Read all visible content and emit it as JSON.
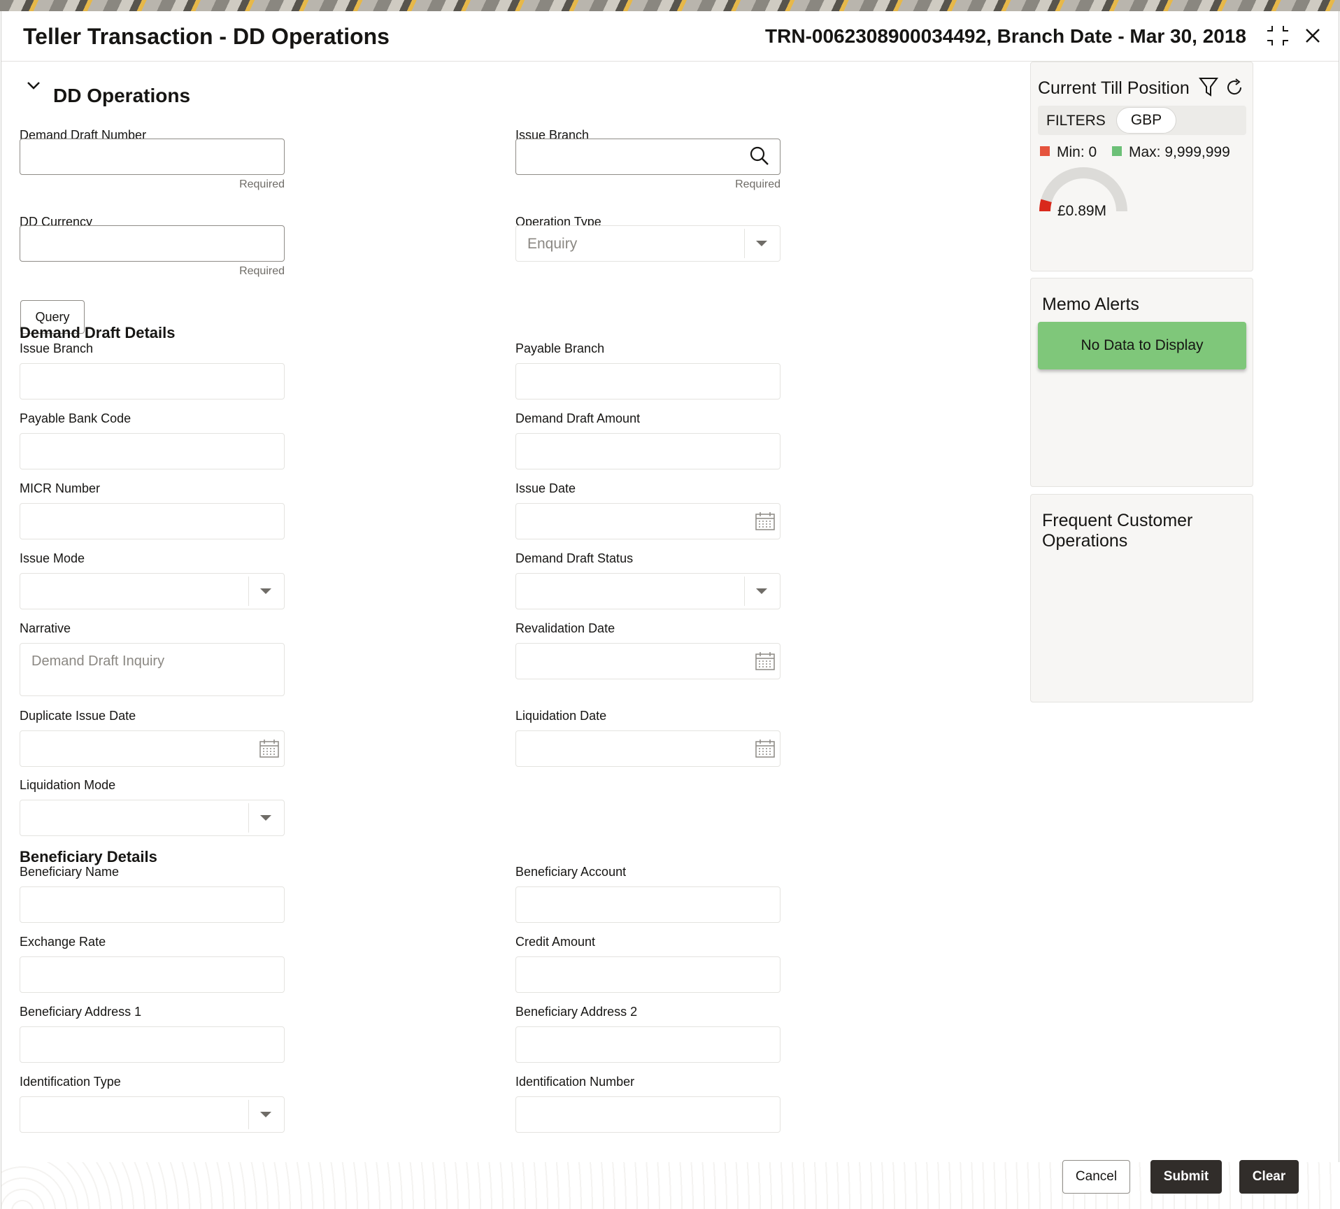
{
  "header": {
    "title": "Teller Transaction - DD Operations",
    "reference": "TRN-0062308900034492, Branch Date - Mar 30, 2018"
  },
  "section": {
    "title": "DD Operations"
  },
  "query_form": {
    "dd_number_label": "Demand Draft Number",
    "issue_branch_label": "Issue Branch",
    "dd_currency_label": "DD Currency",
    "operation_type_label": "Operation Type",
    "operation_type_value": "Enquiry",
    "required_text": "Required",
    "query_button": "Query"
  },
  "dd_details": {
    "heading": "Demand Draft Details",
    "issue_branch_label": "Issue Branch",
    "payable_branch_label": "Payable Branch",
    "payable_bank_code_label": "Payable Bank Code",
    "dd_amount_label": "Demand Draft Amount",
    "micr_label": "MICR Number",
    "issue_date_label": "Issue Date",
    "issue_mode_label": "Issue Mode",
    "dd_status_label": "Demand Draft Status",
    "narrative_label": "Narrative",
    "narrative_value": "Demand Draft Inquiry",
    "revalidation_date_label": "Revalidation Date",
    "duplicate_issue_date_label": "Duplicate Issue Date",
    "liquidation_date_label": "Liquidation Date",
    "liquidation_mode_label": "Liquidation Mode"
  },
  "beneficiary": {
    "heading": "Beneficiary Details",
    "name_label": "Beneficiary Name",
    "account_label": "Beneficiary Account",
    "exchange_rate_label": "Exchange Rate",
    "credit_amount_label": "Credit Amount",
    "address1_label": "Beneficiary Address 1",
    "address2_label": "Beneficiary Address 2",
    "id_type_label": "Identification Type",
    "id_number_label": "Identification Number"
  },
  "till": {
    "title": "Current Till Position",
    "filters_label": "FILTERS",
    "currency_chip": "GBP",
    "min_label": "Min: 0",
    "max_label": "Max: 9,999,999",
    "gauge_value": "£0.89M",
    "gauge_fraction": 0.089,
    "min_color": "#e5533d",
    "max_color": "#6cc077"
  },
  "memo": {
    "title": "Memo Alerts",
    "empty_text": "No Data to Display"
  },
  "frequent": {
    "title_line1": "Frequent Customer",
    "title_line2": "Operations"
  },
  "footer": {
    "cancel": "Cancel",
    "submit": "Submit",
    "clear": "Clear"
  }
}
